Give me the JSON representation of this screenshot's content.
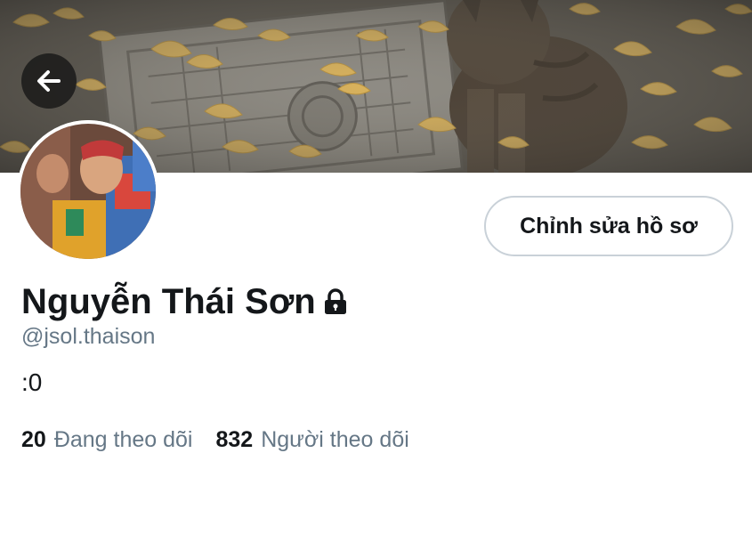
{
  "profile": {
    "display_name": "Nguyễn Thái Sơn",
    "username": "@jsol.thaison",
    "bio": ":0",
    "locked": true
  },
  "header": {
    "back_icon": "arrow-left-icon",
    "edit_profile_label": "Chỉnh sửa hồ sơ"
  },
  "stats": {
    "following_count": "20",
    "following_label": "Đang theo dõi",
    "followers_count": "832",
    "followers_label": "Người theo dõi"
  },
  "colors": {
    "primary_text": "#14171a",
    "secondary_text": "#657786",
    "button_border": "#c9d1d8",
    "background": "#ffffff"
  }
}
